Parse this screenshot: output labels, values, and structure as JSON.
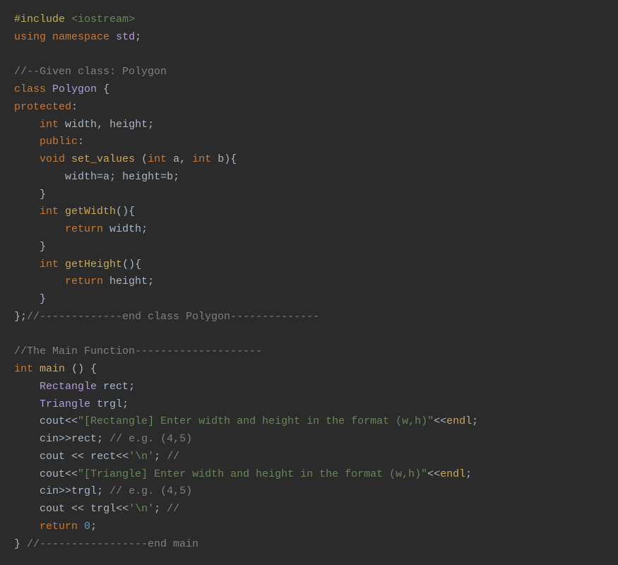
{
  "code": {
    "lines": [
      {
        "tokens": [
          {
            "cls": "preproc",
            "t": "#include"
          },
          {
            "cls": "white",
            "t": " "
          },
          {
            "cls": "angle",
            "t": "<iostream>"
          }
        ]
      },
      {
        "tokens": [
          {
            "cls": "kw",
            "t": "using"
          },
          {
            "cls": "white",
            "t": " "
          },
          {
            "cls": "kw",
            "t": "namespace"
          },
          {
            "cls": "white",
            "t": " "
          },
          {
            "cls": "cls",
            "t": "std"
          },
          {
            "cls": "punc",
            "t": ";"
          }
        ]
      },
      {
        "tokens": []
      },
      {
        "tokens": [
          {
            "cls": "cmt",
            "t": "//--Given class: Polygon"
          }
        ]
      },
      {
        "tokens": [
          {
            "cls": "kw",
            "t": "class"
          },
          {
            "cls": "white",
            "t": " "
          },
          {
            "cls": "cls",
            "t": "Polygon"
          },
          {
            "cls": "white",
            "t": " "
          },
          {
            "cls": "punc",
            "t": "{"
          }
        ]
      },
      {
        "tokens": [
          {
            "cls": "kw",
            "t": "protected"
          },
          {
            "cls": "punc",
            "t": ":"
          }
        ]
      },
      {
        "tokens": [
          {
            "cls": "white",
            "t": "    "
          },
          {
            "cls": "type",
            "t": "int"
          },
          {
            "cls": "white",
            "t": " "
          },
          {
            "cls": "ident",
            "t": "width"
          },
          {
            "cls": "punc",
            "t": ", "
          },
          {
            "cls": "ident",
            "t": "height"
          },
          {
            "cls": "punc",
            "t": ";"
          }
        ]
      },
      {
        "tokens": [
          {
            "cls": "white",
            "t": "    "
          },
          {
            "cls": "kw",
            "t": "public"
          },
          {
            "cls": "punc",
            "t": ":"
          }
        ]
      },
      {
        "tokens": [
          {
            "cls": "white",
            "t": "    "
          },
          {
            "cls": "type",
            "t": "void"
          },
          {
            "cls": "white",
            "t": " "
          },
          {
            "cls": "fn",
            "t": "set_values"
          },
          {
            "cls": "white",
            "t": " "
          },
          {
            "cls": "punc",
            "t": "("
          },
          {
            "cls": "type",
            "t": "int"
          },
          {
            "cls": "white",
            "t": " "
          },
          {
            "cls": "param",
            "t": "a"
          },
          {
            "cls": "punc",
            "t": ", "
          },
          {
            "cls": "type",
            "t": "int"
          },
          {
            "cls": "white",
            "t": " "
          },
          {
            "cls": "param",
            "t": "b"
          },
          {
            "cls": "punc",
            "t": "){"
          }
        ]
      },
      {
        "tokens": [
          {
            "cls": "white",
            "t": "        "
          },
          {
            "cls": "ident",
            "t": "width"
          },
          {
            "cls": "op",
            "t": "="
          },
          {
            "cls": "ident",
            "t": "a"
          },
          {
            "cls": "punc",
            "t": "; "
          },
          {
            "cls": "ident",
            "t": "height"
          },
          {
            "cls": "op",
            "t": "="
          },
          {
            "cls": "ident",
            "t": "b"
          },
          {
            "cls": "punc",
            "t": ";"
          }
        ]
      },
      {
        "tokens": [
          {
            "cls": "white",
            "t": "    "
          },
          {
            "cls": "punc",
            "t": "}"
          }
        ]
      },
      {
        "tokens": [
          {
            "cls": "white",
            "t": "    "
          },
          {
            "cls": "type",
            "t": "int"
          },
          {
            "cls": "white",
            "t": " "
          },
          {
            "cls": "fn",
            "t": "getWidth"
          },
          {
            "cls": "punc",
            "t": "(){"
          }
        ]
      },
      {
        "tokens": [
          {
            "cls": "white",
            "t": "        "
          },
          {
            "cls": "kw",
            "t": "return"
          },
          {
            "cls": "white",
            "t": " "
          },
          {
            "cls": "ident",
            "t": "width"
          },
          {
            "cls": "punc",
            "t": ";"
          }
        ]
      },
      {
        "tokens": [
          {
            "cls": "white",
            "t": "    "
          },
          {
            "cls": "punc",
            "t": "}"
          }
        ]
      },
      {
        "tokens": [
          {
            "cls": "white",
            "t": "    "
          },
          {
            "cls": "type",
            "t": "int"
          },
          {
            "cls": "white",
            "t": " "
          },
          {
            "cls": "fn",
            "t": "getHeight"
          },
          {
            "cls": "punc",
            "t": "(){"
          }
        ]
      },
      {
        "tokens": [
          {
            "cls": "white",
            "t": "        "
          },
          {
            "cls": "kw",
            "t": "return"
          },
          {
            "cls": "white",
            "t": " "
          },
          {
            "cls": "ident",
            "t": "height"
          },
          {
            "cls": "punc",
            "t": ";"
          }
        ]
      },
      {
        "tokens": [
          {
            "cls": "white",
            "t": "    "
          },
          {
            "cls": "punc",
            "t": "}"
          }
        ]
      },
      {
        "tokens": [
          {
            "cls": "punc",
            "t": "};"
          },
          {
            "cls": "cmt",
            "t": "//-------------end class Polygon--------------"
          }
        ]
      },
      {
        "tokens": []
      },
      {
        "tokens": [
          {
            "cls": "cmt",
            "t": "//The Main Function--------------------"
          }
        ]
      },
      {
        "tokens": [
          {
            "cls": "type",
            "t": "int"
          },
          {
            "cls": "white",
            "t": " "
          },
          {
            "cls": "fn",
            "t": "main"
          },
          {
            "cls": "white",
            "t": " "
          },
          {
            "cls": "punc",
            "t": "() {"
          }
        ]
      },
      {
        "tokens": [
          {
            "cls": "white",
            "t": "    "
          },
          {
            "cls": "cls",
            "t": "Rectangle"
          },
          {
            "cls": "white",
            "t": " "
          },
          {
            "cls": "ident",
            "t": "rect"
          },
          {
            "cls": "punc",
            "t": ";"
          }
        ]
      },
      {
        "tokens": [
          {
            "cls": "white",
            "t": "    "
          },
          {
            "cls": "cls",
            "t": "Triangle"
          },
          {
            "cls": "white",
            "t": " "
          },
          {
            "cls": "ident",
            "t": "trgl"
          },
          {
            "cls": "punc",
            "t": ";"
          }
        ]
      },
      {
        "tokens": [
          {
            "cls": "white",
            "t": "    "
          },
          {
            "cls": "ident",
            "t": "cout"
          },
          {
            "cls": "op",
            "t": "<<"
          },
          {
            "cls": "strlit",
            "t": "\"[Rectangle] Enter width and height in the format (w,h)\""
          },
          {
            "cls": "op",
            "t": "<<"
          },
          {
            "cls": "fn",
            "t": "endl"
          },
          {
            "cls": "punc",
            "t": ";"
          }
        ]
      },
      {
        "tokens": [
          {
            "cls": "white",
            "t": "    "
          },
          {
            "cls": "ident",
            "t": "cin"
          },
          {
            "cls": "op",
            "t": ">>"
          },
          {
            "cls": "ident",
            "t": "rect"
          },
          {
            "cls": "punc",
            "t": "; "
          },
          {
            "cls": "cmt",
            "t": "// e.g. (4,5)"
          }
        ]
      },
      {
        "tokens": [
          {
            "cls": "white",
            "t": "    "
          },
          {
            "cls": "ident",
            "t": "cout"
          },
          {
            "cls": "white",
            "t": " "
          },
          {
            "cls": "op",
            "t": "<<"
          },
          {
            "cls": "white",
            "t": " "
          },
          {
            "cls": "ident",
            "t": "rect"
          },
          {
            "cls": "op",
            "t": "<<"
          },
          {
            "cls": "chrlit",
            "t": "'\\n'"
          },
          {
            "cls": "punc",
            "t": "; "
          },
          {
            "cls": "cmt",
            "t": "//"
          }
        ]
      },
      {
        "tokens": [
          {
            "cls": "white",
            "t": "    "
          },
          {
            "cls": "ident",
            "t": "cout"
          },
          {
            "cls": "op",
            "t": "<<"
          },
          {
            "cls": "strlit",
            "t": "\"[Triangle] Enter width and height in the format (w,h)\""
          },
          {
            "cls": "op",
            "t": "<<"
          },
          {
            "cls": "fn",
            "t": "endl"
          },
          {
            "cls": "punc",
            "t": ";"
          }
        ]
      },
      {
        "tokens": [
          {
            "cls": "white",
            "t": "    "
          },
          {
            "cls": "ident",
            "t": "cin"
          },
          {
            "cls": "op",
            "t": ">>"
          },
          {
            "cls": "ident",
            "t": "trgl"
          },
          {
            "cls": "punc",
            "t": "; "
          },
          {
            "cls": "cmt",
            "t": "// e.g. (4,5)"
          }
        ]
      },
      {
        "tokens": [
          {
            "cls": "white",
            "t": "    "
          },
          {
            "cls": "ident",
            "t": "cout"
          },
          {
            "cls": "white",
            "t": " "
          },
          {
            "cls": "op",
            "t": "<<"
          },
          {
            "cls": "white",
            "t": " "
          },
          {
            "cls": "ident",
            "t": "trgl"
          },
          {
            "cls": "op",
            "t": "<<"
          },
          {
            "cls": "chrlit",
            "t": "'\\n'"
          },
          {
            "cls": "punc",
            "t": "; "
          },
          {
            "cls": "cmt",
            "t": "//"
          }
        ]
      },
      {
        "tokens": [
          {
            "cls": "white",
            "t": "    "
          },
          {
            "cls": "kw",
            "t": "return"
          },
          {
            "cls": "white",
            "t": " "
          },
          {
            "cls": "num",
            "t": "0"
          },
          {
            "cls": "punc",
            "t": ";"
          }
        ]
      },
      {
        "tokens": [
          {
            "cls": "punc",
            "t": "} "
          },
          {
            "cls": "cmt",
            "t": "//-----------------end main"
          }
        ]
      }
    ]
  }
}
